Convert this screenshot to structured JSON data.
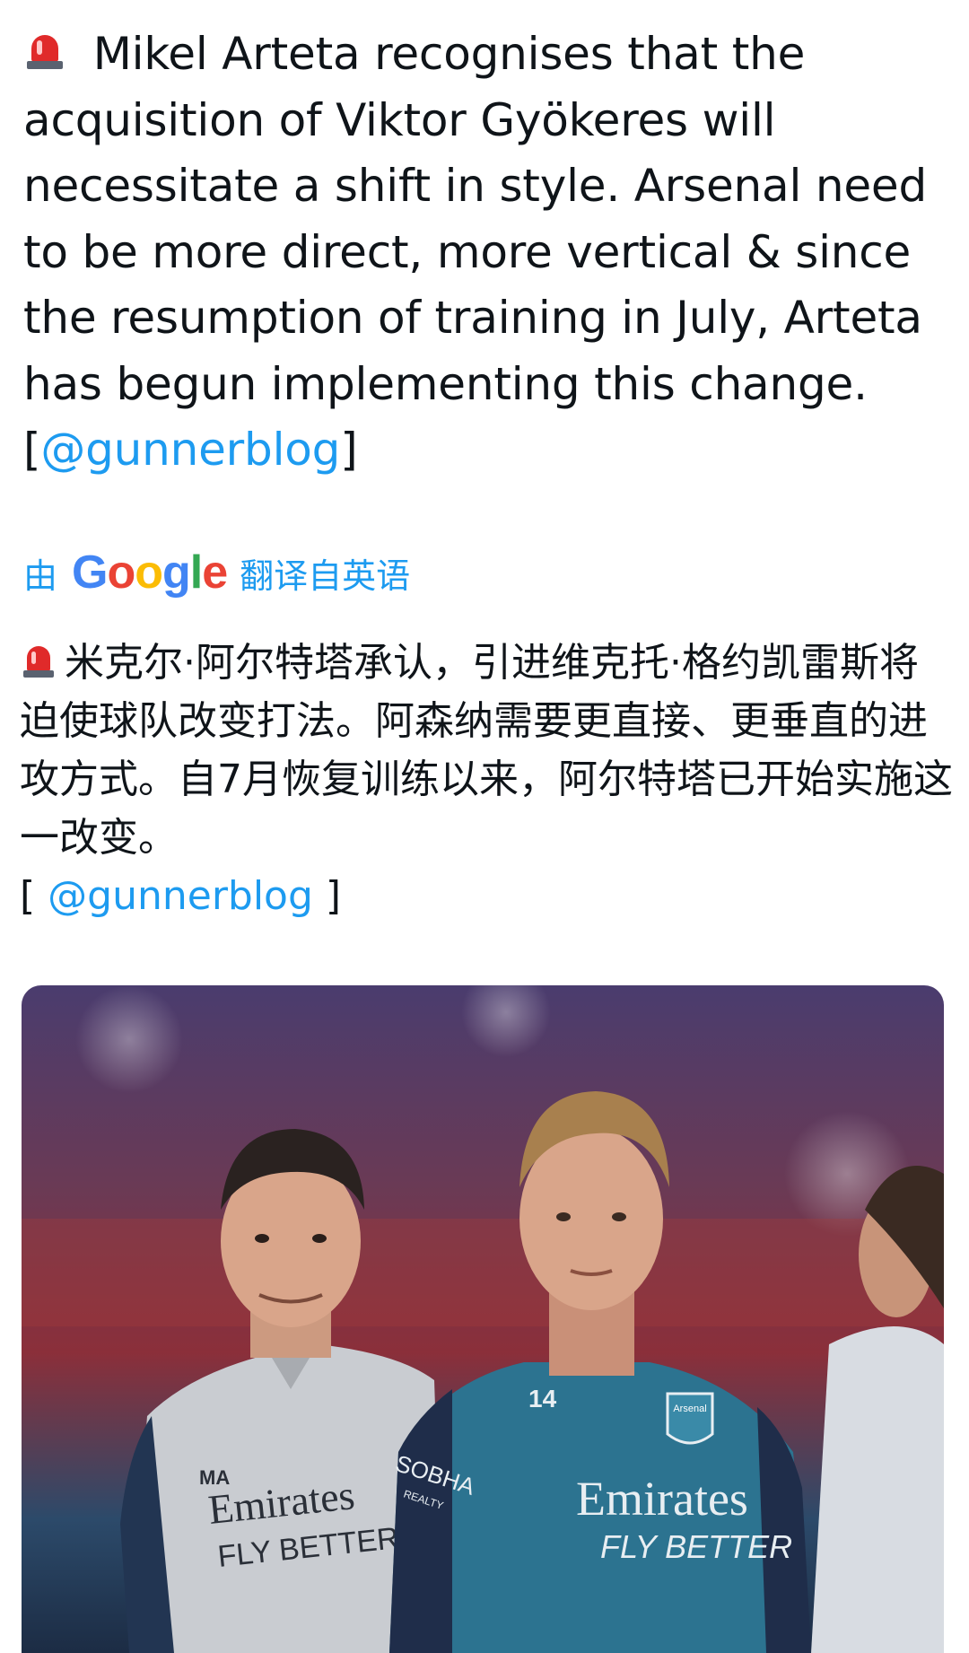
{
  "post": {
    "emoji": "rotating-light-icon",
    "text_before": " Mikel Arteta recognises that the acquisition of Viktor Gyökeres will necessitate a shift in style. Arsenal need to be more direct, more vertical & since the resumption of training in July, Arteta has begun implementing this change. [",
    "mention": "@gunnerblog",
    "text_after": "]"
  },
  "translation": {
    "by_label": "由",
    "provider": "Google",
    "google_letters": [
      "G",
      "o",
      "o",
      "g",
      "l",
      "e"
    ],
    "suffix_label": "翻译自英语",
    "text_before": "米克尔·阿尔特塔承认，引进维克托·格约凯雷斯将迫使球队改变打法。阿森纳需要更直接、更垂直的进攻方式。自7月恢复训练以来，阿尔特塔已开始实施这一改变。",
    "line2_open": "[ ",
    "mention": "@gunnerblog",
    "line2_close": " ]"
  },
  "photo": {
    "left_shirt_text": "Emirates",
    "left_shirt_sub": "FLY BETTER",
    "left_initials": "MA",
    "right_shirt_text": "Emirates",
    "right_shirt_sub": "FLY BETTER",
    "right_number": "14",
    "sleeve_text": "SOBHA",
    "sleeve_sub": "REALTY",
    "crest_text": "Arsenal",
    "colors": {
      "teal_shirt": "#2c7390",
      "grey_shirt": "#c9ccd1",
      "skin": "#d9a58a"
    }
  }
}
